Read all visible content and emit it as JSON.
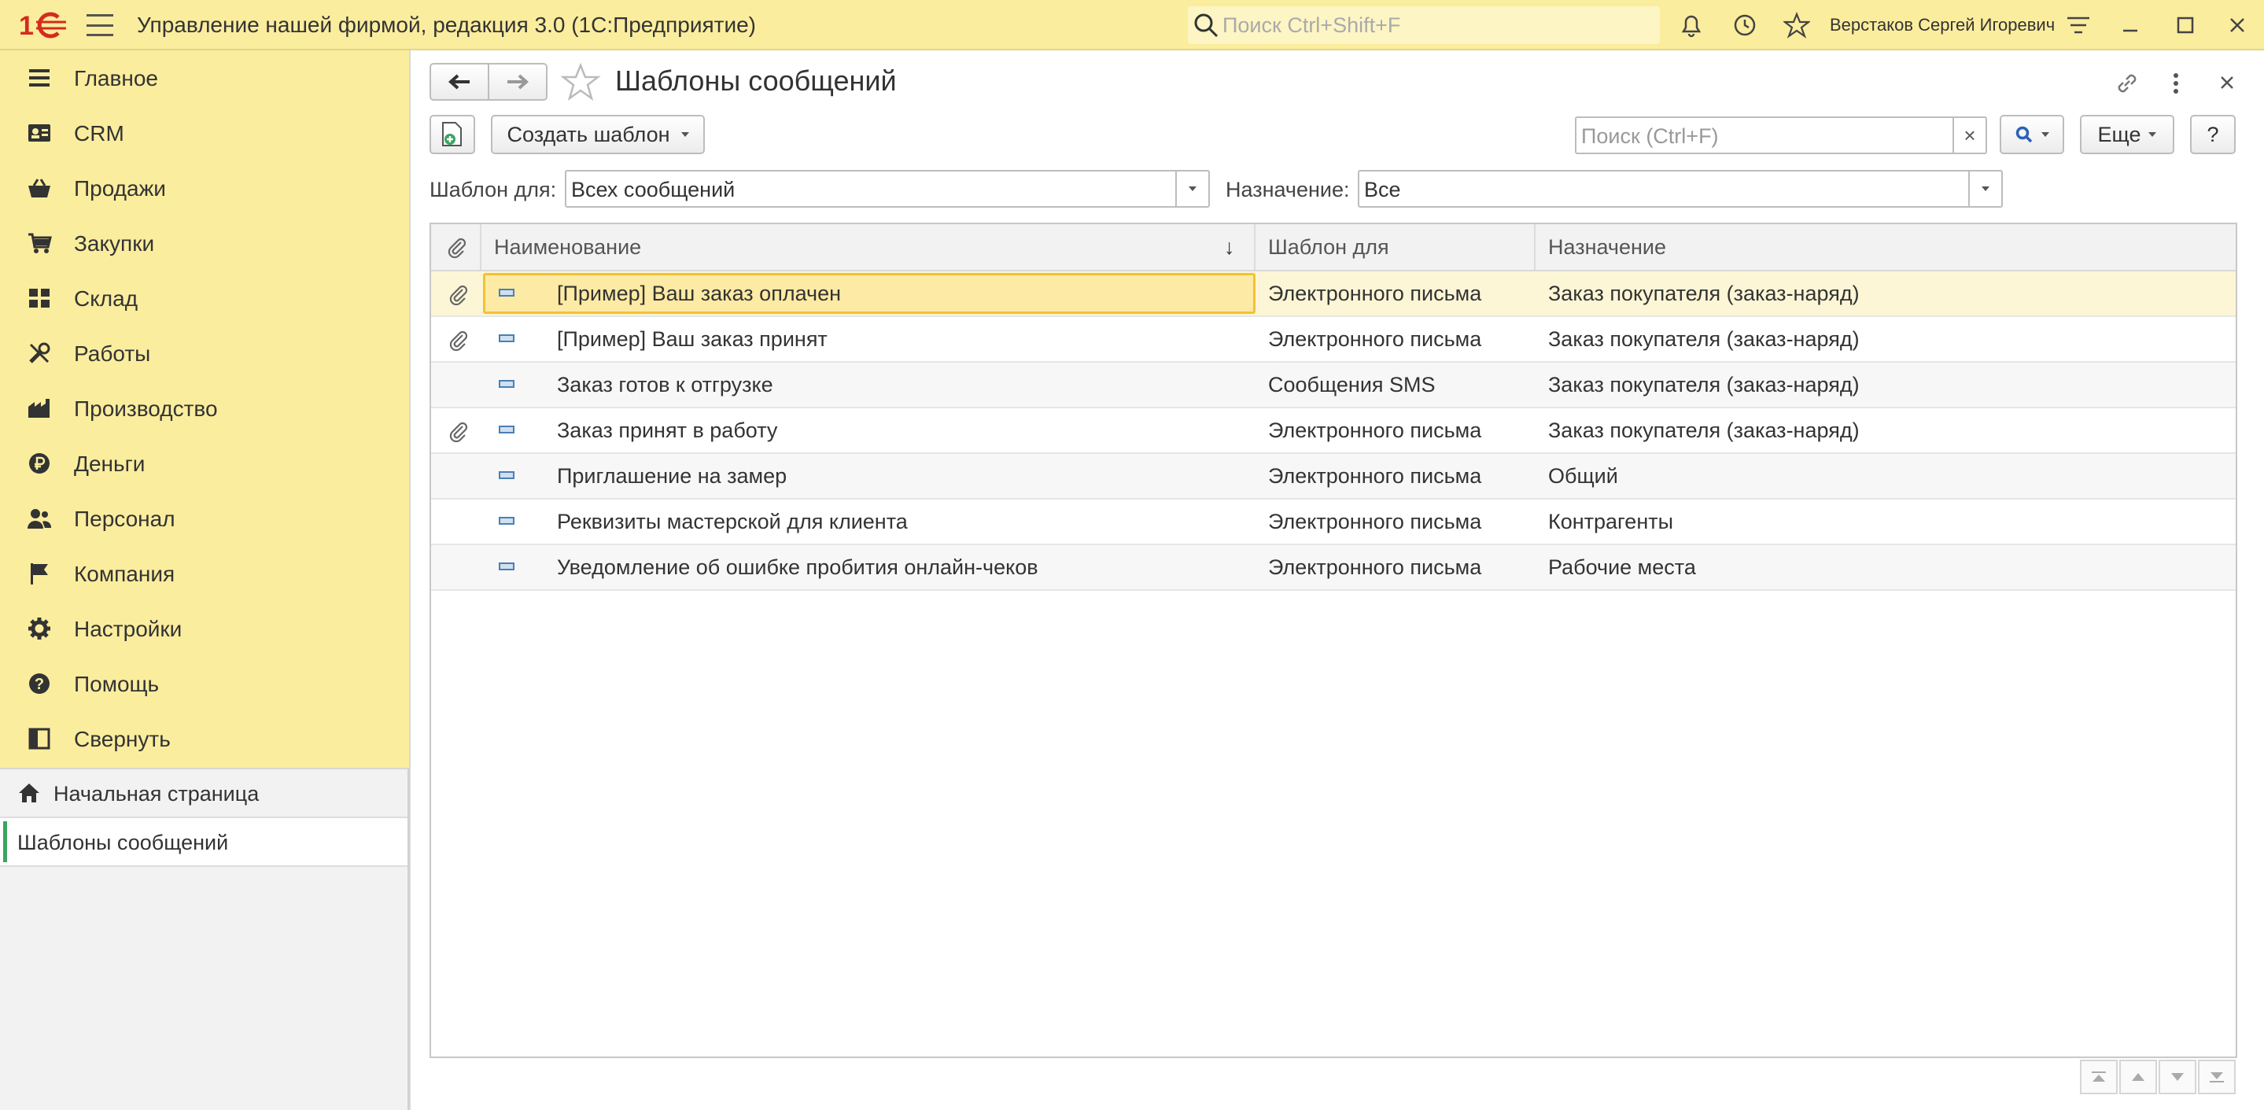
{
  "app": {
    "title": "Управление нашей фирмой, редакция 3.0  (1С:Предприятие)",
    "search_placeholder": "Поиск Ctrl+Shift+F",
    "user_name": "Верстаков Сергей Игоревич",
    "brand_color": "#d52b1e",
    "panel_color": "#fbed9e"
  },
  "sidebar": {
    "items": [
      {
        "label": "Главное",
        "icon": "list-icon"
      },
      {
        "label": "CRM",
        "icon": "contacts-icon"
      },
      {
        "label": "Продажи",
        "icon": "basket-icon"
      },
      {
        "label": "Закупки",
        "icon": "cart-icon"
      },
      {
        "label": "Склад",
        "icon": "grid-icon"
      },
      {
        "label": "Работы",
        "icon": "tools-icon"
      },
      {
        "label": "Производство",
        "icon": "factory-icon"
      },
      {
        "label": "Деньги",
        "icon": "ruble-icon"
      },
      {
        "label": "Персонал",
        "icon": "people-icon"
      },
      {
        "label": "Компания",
        "icon": "flag-icon"
      },
      {
        "label": "Настройки",
        "icon": "gear-icon"
      },
      {
        "label": "Помощь",
        "icon": "help-icon"
      },
      {
        "label": "Свернуть",
        "icon": "collapse-icon"
      }
    ]
  },
  "open_pages": {
    "home": "Начальная страница",
    "current": "Шаблоны сообщений"
  },
  "form": {
    "title": "Шаблоны сообщений",
    "create_button": "Создать шаблон",
    "search_placeholder": "Поиск (Ctrl+F)",
    "more_button": "Еще",
    "help_button": "?",
    "clear_button": "×",
    "template_for_label": "Шаблон для:",
    "template_for_value": "Всех сообщений",
    "purpose_label": "Назначение:",
    "purpose_value": "Все"
  },
  "table": {
    "columns": [
      "Наименование",
      "Шаблон для",
      "Назначение"
    ],
    "sort_indicator": "↓",
    "rows": [
      {
        "attachment": true,
        "name": "[Пример] Ваш заказ оплачен",
        "template_for": "Электронного письма",
        "purpose": "Заказ покупателя (заказ-наряд)",
        "selected": true
      },
      {
        "attachment": true,
        "name": "[Пример] Ваш заказ принят",
        "template_for": "Электронного письма",
        "purpose": "Заказ покупателя (заказ-наряд)"
      },
      {
        "attachment": false,
        "name": "Заказ готов к отгрузке",
        "template_for": "Сообщения SMS",
        "purpose": "Заказ покупателя (заказ-наряд)"
      },
      {
        "attachment": true,
        "name": "Заказ принят в работу",
        "template_for": "Электронного письма",
        "purpose": "Заказ покупателя (заказ-наряд)"
      },
      {
        "attachment": false,
        "name": "Приглашение на замер",
        "template_for": "Электронного письма",
        "purpose": "Общий"
      },
      {
        "attachment": false,
        "name": "Реквизиты мастерской для клиента",
        "template_for": "Электронного письма",
        "purpose": "Контрагенты"
      },
      {
        "attachment": false,
        "name": "Уведомление об ошибке пробития онлайн-чеков",
        "template_for": "Электронного письма",
        "purpose": "Рабочие места"
      }
    ]
  }
}
